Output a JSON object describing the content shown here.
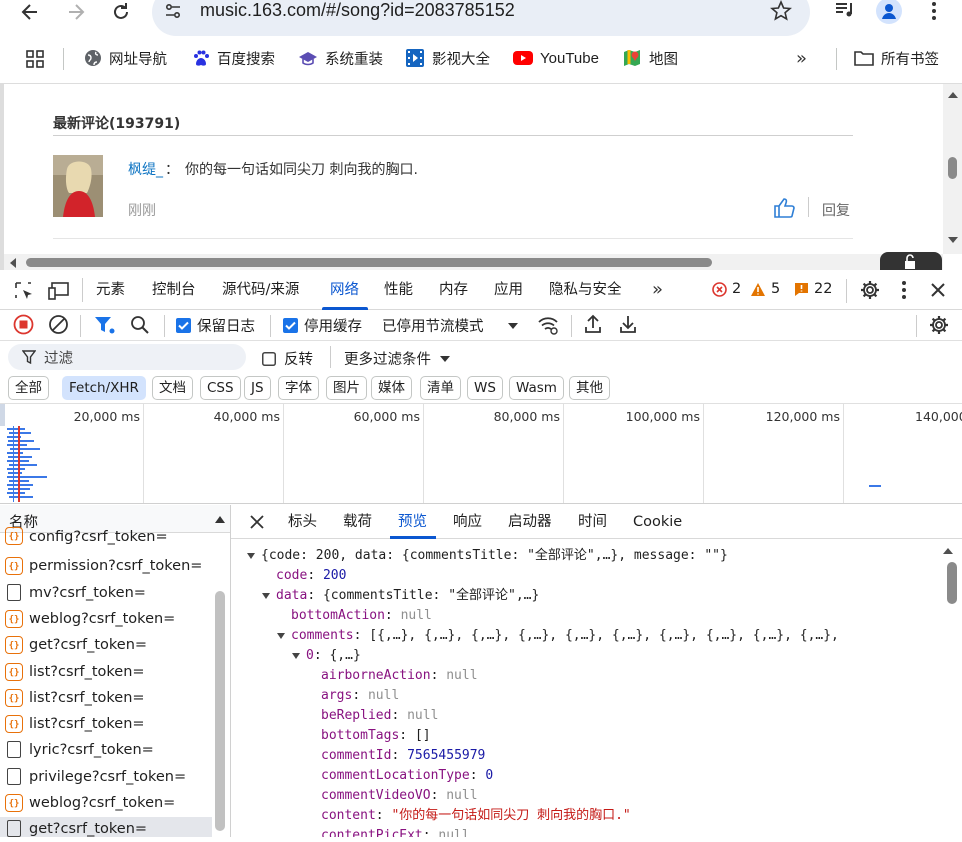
{
  "browser": {
    "url": "music.163.com/#/song?id=2083785152",
    "bookmarks": [
      {
        "label": "网址导航",
        "icon": "globe-icon"
      },
      {
        "label": "百度搜索",
        "icon": "baidu-paw-icon"
      },
      {
        "label": "系统重装",
        "icon": "hat-icon"
      },
      {
        "label": "影视大全",
        "icon": "film-icon"
      },
      {
        "label": "YouTube",
        "icon": "youtube-icon"
      },
      {
        "label": "地图",
        "icon": "map-icon"
      }
    ],
    "all_bookmarks": "所有书签"
  },
  "page": {
    "section_title": "最新评论(193791)",
    "comment": {
      "user": "枫缇_",
      "separator": "：",
      "text": "你的每一句话如同尖刀 刺向我的胸口.",
      "time": "刚刚",
      "reply": "回复"
    }
  },
  "devtools": {
    "tabs": [
      "元素",
      "控制台",
      "源代码/来源",
      "网络",
      "性能",
      "内存",
      "应用",
      "隐私与安全"
    ],
    "active_tab": "网络",
    "errors": "2",
    "warnings": "5",
    "issues": "22",
    "toolbar": {
      "preserve_log": "保留日志",
      "disable_cache": "停用缓存",
      "throttle": "已停用节流模式"
    },
    "filter": {
      "placeholder": "过滤",
      "invert": "反转",
      "more": "更多过滤条件"
    },
    "type_filters": [
      "全部",
      "Fetch/XHR",
      "文档",
      "CSS",
      "JS",
      "字体",
      "图片",
      "媒体",
      "清单",
      "WS",
      "Wasm",
      "其他"
    ],
    "active_type_filter": "Fetch/XHR",
    "timeline_ticks": [
      "20,000 ms",
      "40,000 ms",
      "60,000 ms",
      "80,000 ms",
      "100,000 ms",
      "120,000 ms",
      "140,000"
    ],
    "request_header": "名称",
    "requests": [
      {
        "name": "config?csrf_token=",
        "type": "xhr"
      },
      {
        "name": "permission?csrf_token=",
        "type": "xhr"
      },
      {
        "name": "mv?csrf_token=",
        "type": "doc"
      },
      {
        "name": "weblog?csrf_token=",
        "type": "xhr"
      },
      {
        "name": "get?csrf_token=",
        "type": "xhr"
      },
      {
        "name": "list?csrf_token=",
        "type": "xhr"
      },
      {
        "name": "list?csrf_token=",
        "type": "xhr"
      },
      {
        "name": "list?csrf_token=",
        "type": "xhr"
      },
      {
        "name": "lyric?csrf_token=",
        "type": "doc"
      },
      {
        "name": "privilege?csrf_token=",
        "type": "doc"
      },
      {
        "name": "weblog?csrf_token=",
        "type": "xhr"
      },
      {
        "name": "get?csrf_token=",
        "type": "doc"
      }
    ],
    "detail_tabs": [
      "标头",
      "载荷",
      "预览",
      "响应",
      "启动器",
      "时间",
      "Cookie"
    ],
    "active_detail_tab": "预览",
    "preview": {
      "root": "{code: 200, data: {commentsTitle: \"全部评论\",…}, message: \"\"}",
      "code_key": "code",
      "code_val": "200",
      "data_key": "data",
      "data_val": "{commentsTitle: \"全部评论\",…}",
      "bottomAction_key": "bottomAction",
      "bottomAction_val": "null",
      "comments_key": "comments",
      "comments_val": "[{,…}, {,…}, {,…}, {,…}, {,…}, {,…}, {,…}, {,…}, {,…}, {,…},",
      "item0_key": "0",
      "item0_val": "{,…}",
      "fields": [
        {
          "key": "airborneAction",
          "value": "null",
          "kind": "null"
        },
        {
          "key": "args",
          "value": "null",
          "kind": "null"
        },
        {
          "key": "beReplied",
          "value": "null",
          "kind": "null"
        },
        {
          "key": "bottomTags",
          "value": "[]",
          "kind": "plain"
        },
        {
          "key": "commentId",
          "value": "7565455979",
          "kind": "num"
        },
        {
          "key": "commentLocationType",
          "value": "0",
          "kind": "num"
        },
        {
          "key": "commentVideoVO",
          "value": "null",
          "kind": "null"
        },
        {
          "key": "content",
          "value": "\"你的每一句话如同尖刀   刺向我的胸口.\"",
          "kind": "str"
        },
        {
          "key": "contentPicExt",
          "value": "null",
          "kind": "null"
        }
      ]
    }
  }
}
